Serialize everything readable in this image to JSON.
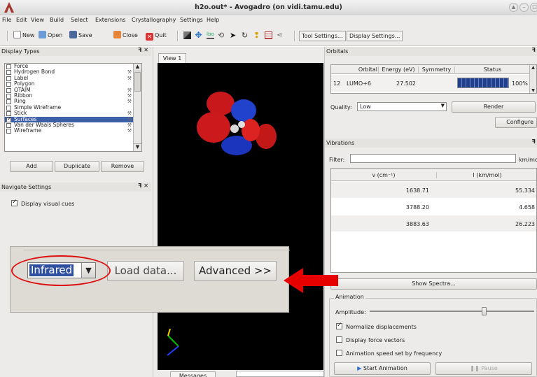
{
  "window": {
    "title": "h2o.out* - Avogadro (on vidi.tamu.edu)"
  },
  "menubar": [
    "File",
    "Edit",
    "View",
    "Build",
    "Select",
    "Extensions",
    "Crystallography",
    "Settings",
    "Help"
  ],
  "toolbar": {
    "new": "New",
    "open": "Open",
    "save": "Save",
    "close": "Close",
    "quit": "Quit",
    "tool_settings": "Tool Settings...",
    "display_settings": "Display Settings..."
  },
  "display_types": {
    "title": "Display Types",
    "items": [
      {
        "label": "Force",
        "checked": false
      },
      {
        "label": "Hydrogen Bond",
        "checked": false
      },
      {
        "label": "Label",
        "checked": false
      },
      {
        "label": "Polygon",
        "checked": false
      },
      {
        "label": "QTAIM",
        "checked": false
      },
      {
        "label": "Ribbon",
        "checked": false
      },
      {
        "label": "Ring",
        "checked": false
      },
      {
        "label": "Simple Wireframe",
        "checked": false
      },
      {
        "label": "Stick",
        "checked": false
      },
      {
        "label": "Surfaces",
        "checked": true
      },
      {
        "label": "Van der Waals Spheres",
        "checked": false
      },
      {
        "label": "Wireframe",
        "checked": false
      }
    ],
    "add": "Add",
    "duplicate": "Duplicate",
    "remove": "Remove"
  },
  "navigate_settings": {
    "title": "Navigate Settings",
    "display_visual_cues": "Display visual cues"
  },
  "view": {
    "tab": "View 1",
    "messages_tab": "Messages"
  },
  "zoom_callout": {
    "spectrum_type": "Infrared",
    "load_data": "Load data...",
    "advanced": "Advanced >>"
  },
  "orbitals": {
    "title": "Orbitals",
    "headers": [
      "Orbital",
      "Energy (eV)",
      "Symmetry",
      "Status"
    ],
    "row": {
      "index": "12",
      "orbital": "LUMO+6",
      "energy": "27.502",
      "symmetry": "",
      "status": "100%"
    },
    "status_progress": 1.0,
    "quality_label": "Quality:",
    "quality_value": "Low",
    "render": "Render",
    "configure": "Configure"
  },
  "vibrations": {
    "title": "Vibrations",
    "filter_label": "Filter:",
    "filter_unit": "km/mol",
    "headers": [
      "ν (cm⁻¹)",
      "I (km/mol)"
    ],
    "rows": [
      {
        "freq": "1638.71",
        "intensity": "55.334"
      },
      {
        "freq": "3788.20",
        "intensity": "4.658"
      },
      {
        "freq": "3883.63",
        "intensity": "26.223"
      }
    ],
    "show_spectra": "Show Spectra...",
    "animation_group": "Animation",
    "amplitude_label": "Amplitude:",
    "amplitude_level": 0.68,
    "normalize": "Normalize displacements",
    "normalize_checked": true,
    "force_vectors": "Display force vectors",
    "force_checked": false,
    "anim_speed": "Animation speed set by frequency",
    "anim_checked": false,
    "start_animation": "Start Animation",
    "pause": "Pause"
  },
  "colors": {
    "arrow": "#e60000",
    "highlight_circle": "#dd1111",
    "selection": "#3d5fa8",
    "orbital_red": "#d11a1a",
    "orbital_blue": "#1d3fd0"
  }
}
